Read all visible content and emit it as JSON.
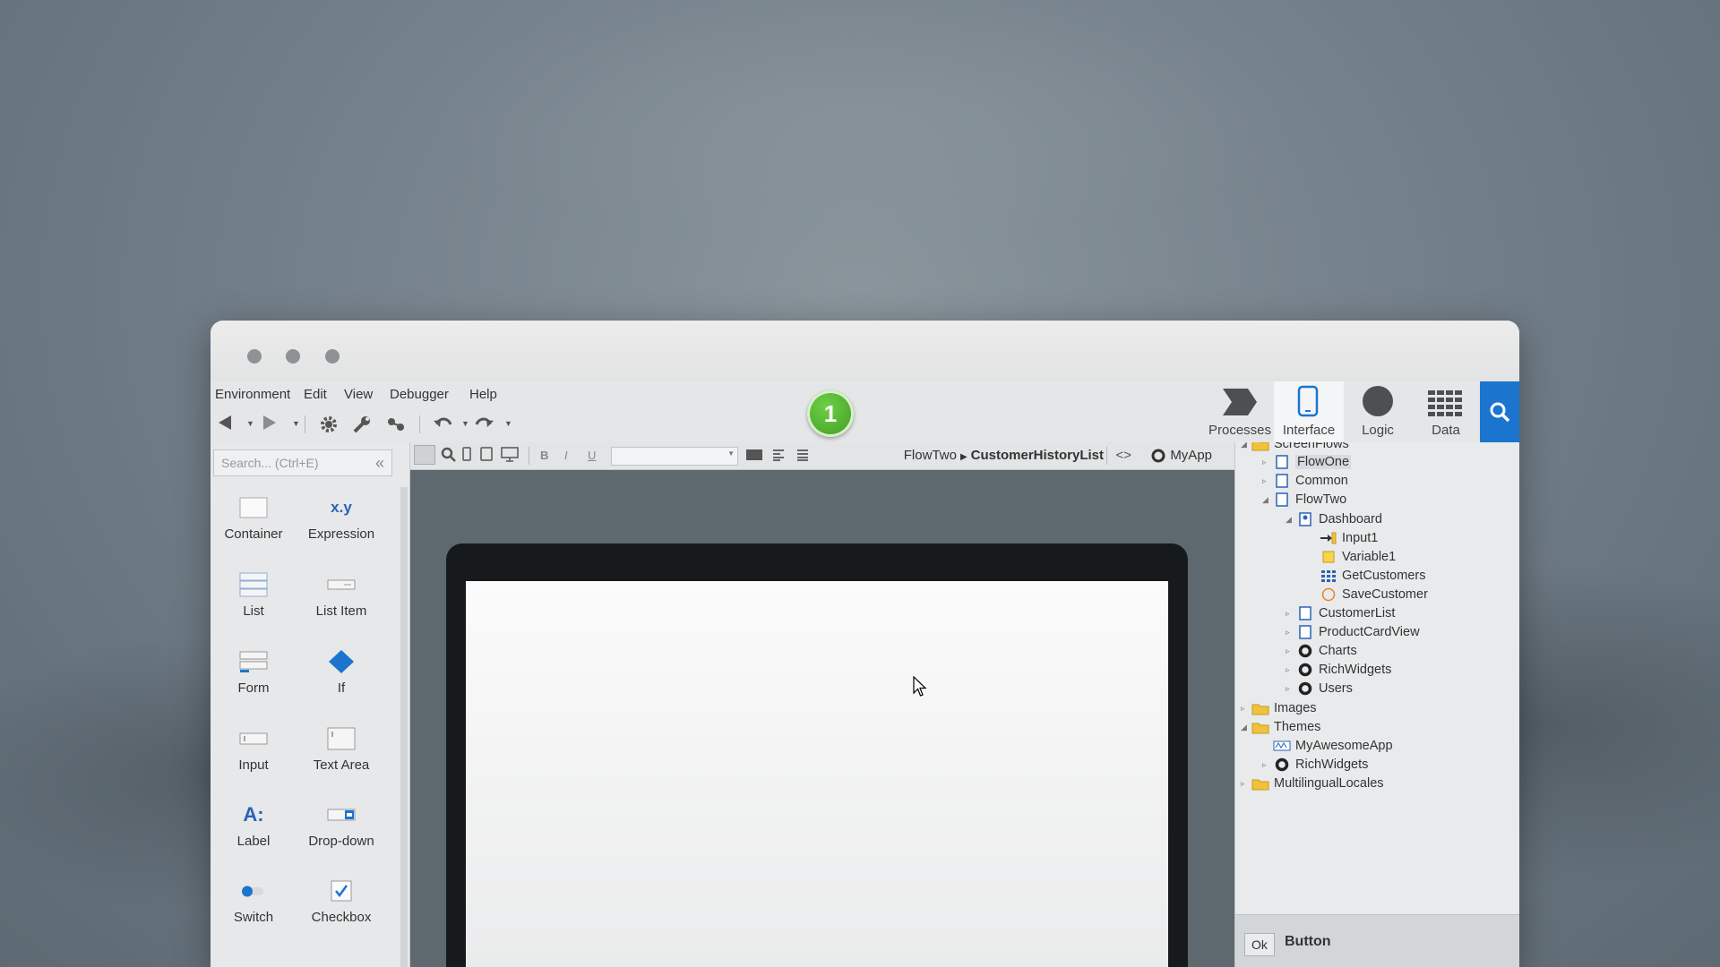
{
  "menu": [
    "Environment",
    "Edit",
    "View",
    "Debugger",
    "Help"
  ],
  "badge": "1",
  "tabs": [
    {
      "label": "Processes",
      "icon": "processes-icon"
    },
    {
      "label": "Interface",
      "icon": "interface-icon",
      "active": true
    },
    {
      "label": "Logic",
      "icon": "logic-icon"
    },
    {
      "label": "Data",
      "icon": "data-icon"
    }
  ],
  "accent_color": "#1b75cf",
  "search": {
    "placeholder": "Search... (Ctrl+E)"
  },
  "palette": [
    {
      "label": "Container",
      "icon": "container-icon"
    },
    {
      "label": "Expression",
      "icon": "expression-icon",
      "glyph": "x.y"
    },
    {
      "label": "List",
      "icon": "list-icon"
    },
    {
      "label": "List Item",
      "icon": "list-item-icon"
    },
    {
      "label": "Form",
      "icon": "form-icon"
    },
    {
      "label": "If",
      "icon": "if-icon"
    },
    {
      "label": "Input",
      "icon": "input-icon"
    },
    {
      "label": "Text Area",
      "icon": "text-area-icon"
    },
    {
      "label": "Label",
      "icon": "label-icon",
      "glyph": "A:"
    },
    {
      "label": "Drop-down",
      "icon": "dropdown-icon"
    },
    {
      "label": "Switch",
      "icon": "switch-icon"
    },
    {
      "label": "Checkbox",
      "icon": "checkbox-icon"
    }
  ],
  "editor": {
    "format_buttons": [
      "B",
      "I",
      "U"
    ],
    "breadcrumb_parent": "FlowTwo",
    "breadcrumb_current": "CustomerHistoryList",
    "code_toggle": "<>",
    "module": "MyApp"
  },
  "tree": [
    {
      "label": "ScreenFlows",
      "icon": "folder-icon"
    },
    {
      "label": "FlowOne",
      "icon": "screen-icon",
      "selected": true
    },
    {
      "label": "Common",
      "icon": "screen-icon"
    },
    {
      "label": "FlowTwo",
      "icon": "screen-icon"
    },
    {
      "label": "Dashboard",
      "icon": "screen-icon"
    },
    {
      "label": "Input1",
      "icon": "input-param-icon"
    },
    {
      "label": "Variable1",
      "icon": "variable-icon"
    },
    {
      "label": "GetCustomers",
      "icon": "aggregate-icon"
    },
    {
      "label": "SaveCustomer",
      "icon": "action-icon"
    },
    {
      "label": "CustomerList",
      "icon": "screen-icon"
    },
    {
      "label": "ProductCardView",
      "icon": "screen-icon"
    },
    {
      "label": "Charts",
      "icon": "module-icon"
    },
    {
      "label": "RichWidgets",
      "icon": "module-icon"
    },
    {
      "label": "Users",
      "icon": "module-icon"
    },
    {
      "label": "Images",
      "icon": "folder-icon"
    },
    {
      "label": "Themes",
      "icon": "folder-icon"
    },
    {
      "label": "MyAwesomeApp",
      "icon": "theme-icon"
    },
    {
      "label": "RichWidgets",
      "icon": "module-icon"
    },
    {
      "label": "MultilingualLocales",
      "icon": "folder-icon"
    }
  ],
  "properties": {
    "chip": "Ok",
    "title": "Button"
  }
}
